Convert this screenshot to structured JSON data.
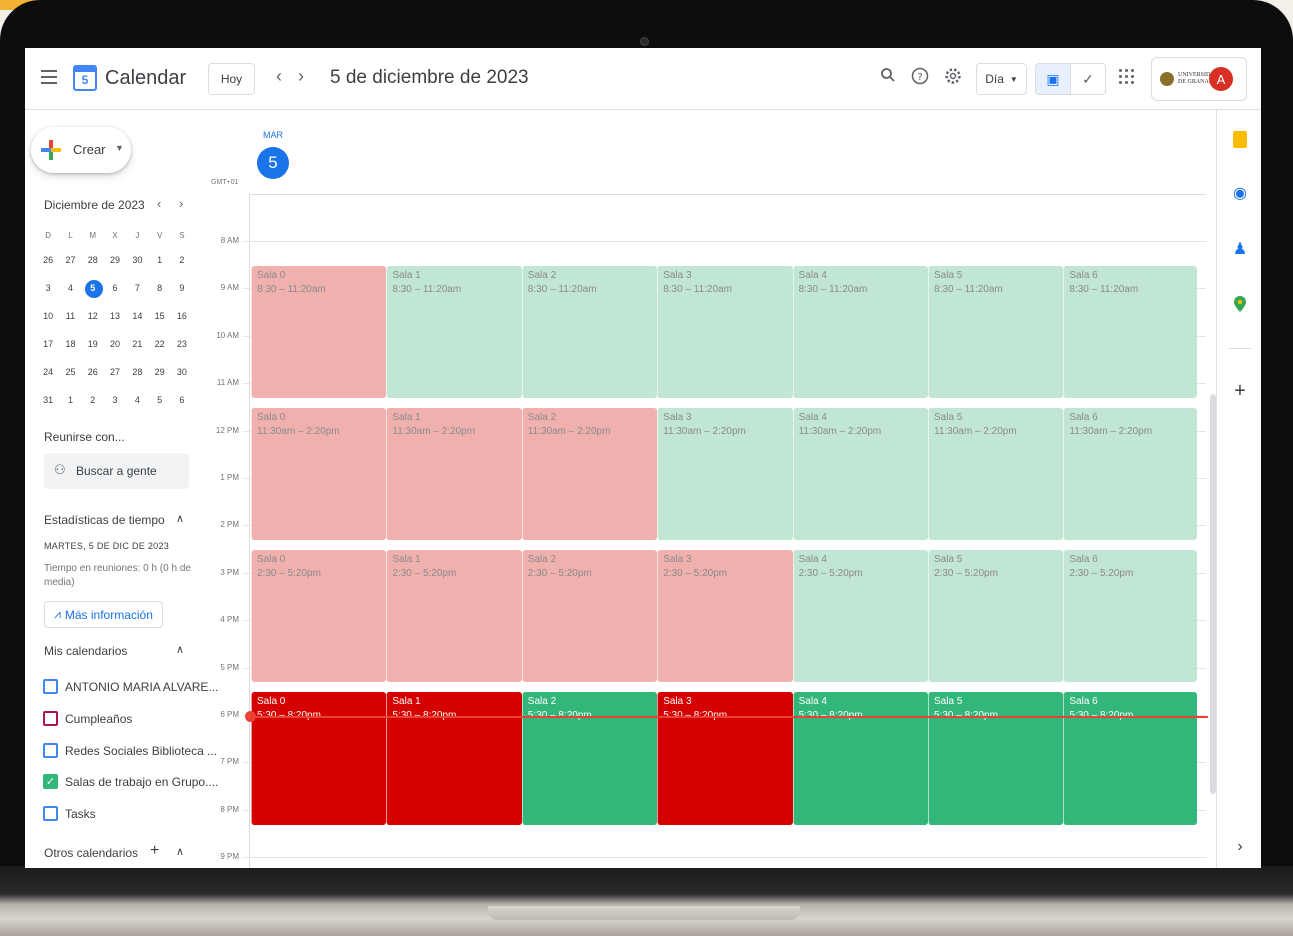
{
  "header": {
    "app_title": "Calendar",
    "logo_day": "5",
    "today_label": "Hoy",
    "prev_icon": "‹",
    "next_icon": "›",
    "date_title": "5 de diciembre de 2023",
    "view_label": "Día",
    "org_name_line1": "UNIVERSIDAD",
    "org_name_line2": "DE GRANADA",
    "avatar_initial": "A"
  },
  "sidebar": {
    "create_label": "Crear",
    "mini_cal": {
      "title": "Diciembre de 2023",
      "dow": [
        "D",
        "L",
        "M",
        "X",
        "J",
        "V",
        "S"
      ],
      "days": [
        "26",
        "27",
        "28",
        "29",
        "30",
        "1",
        "2",
        "3",
        "4",
        "5",
        "6",
        "7",
        "8",
        "9",
        "10",
        "11",
        "12",
        "13",
        "14",
        "15",
        "16",
        "17",
        "18",
        "19",
        "20",
        "21",
        "22",
        "23",
        "24",
        "25",
        "26",
        "27",
        "28",
        "29",
        "30",
        "31",
        "1",
        "2",
        "3",
        "4",
        "5",
        "6"
      ],
      "selected_index": 9
    },
    "meet_title": "Reunirse con...",
    "search_people_placeholder": "Buscar a gente",
    "stats_title": "Estadísticas de tiempo",
    "stats_date": "MARTES, 5 DE DIC DE 2023",
    "stats_meet_time": "Tiempo en reuniones: 0 h (0 h de media)",
    "more_info_label": "Más información",
    "my_calendars_title": "Mis calendarios",
    "my_calendars": [
      {
        "label": "ANTONIO MARIA ALVARE...",
        "checked": false,
        "color": "#4285f4"
      },
      {
        "label": "Cumpleaños",
        "checked": false,
        "color": "#ad1457"
      },
      {
        "label": "Redes Sociales Biblioteca ...",
        "checked": false,
        "color": "#4285f4"
      },
      {
        "label": "Salas de trabajo en Grupo....",
        "checked": true,
        "color": "#33b679"
      },
      {
        "label": "Tasks",
        "checked": false,
        "color": "#4285f4"
      }
    ],
    "other_calendars_title": "Otros calendarios"
  },
  "day_view": {
    "dow": "MAR",
    "day_num": "5",
    "timezone": "GMT+01",
    "hours": [
      "8 AM",
      "9 AM",
      "10 AM",
      "11 AM",
      "12 PM",
      "1 PM",
      "2 PM",
      "3 PM",
      "4 PM",
      "5 PM",
      "6 PM",
      "7 PM",
      "8 PM",
      "9 PM"
    ],
    "slots": [
      {
        "time": "8:30 – 11:20am",
        "start_hour": 8.5,
        "end_hour": 11.333
      },
      {
        "time": "11:30am – 2:20pm",
        "start_hour": 11.5,
        "end_hour": 14.333
      },
      {
        "time": "2:30 – 5:20pm",
        "start_hour": 14.5,
        "end_hour": 17.333
      },
      {
        "time": "5:30 – 8:20pm",
        "start_hour": 17.5,
        "end_hour": 20.333
      }
    ],
    "rooms": [
      "Sala 0",
      "Sala 1",
      "Sala 2",
      "Sala 3",
      "Sala 4",
      "Sala 5",
      "Sala 6"
    ],
    "availability": [
      [
        "busy",
        "free",
        "free",
        "free",
        "free",
        "free",
        "free"
      ],
      [
        "busy",
        "busy",
        "busy",
        "free",
        "free",
        "free",
        "free"
      ],
      [
        "busy",
        "busy",
        "busy",
        "busy",
        "free",
        "free",
        "free"
      ],
      [
        "busy",
        "busy",
        "free",
        "busy",
        "free",
        "free",
        "free"
      ]
    ],
    "current_time_hour": 17.95
  },
  "colors": {
    "past_busy": "#f0b1ae",
    "past_free": "#c2e6d4",
    "busy": "#d50000",
    "free": "#33b679",
    "accent": "#1a73e8",
    "now_line": "#ea4335"
  },
  "right_rail": {
    "icons": [
      "keep-icon",
      "tasks-icon",
      "contacts-icon",
      "maps-icon",
      "add-icon"
    ],
    "expand_icon": "›"
  }
}
